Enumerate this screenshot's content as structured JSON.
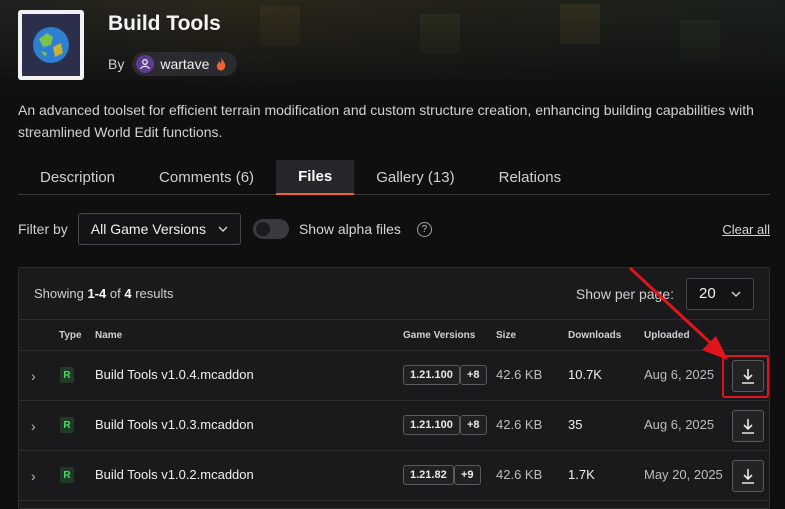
{
  "project": {
    "title": "Build Tools",
    "by_label": "By",
    "author": "wartave",
    "description": "An advanced toolset for efficient terrain modification and custom structure creation, enhancing building capabilities with streamlined World Edit functions."
  },
  "tabs": [
    {
      "label": "Description",
      "active": false
    },
    {
      "label": "Comments (6)",
      "active": false
    },
    {
      "label": "Files",
      "active": true
    },
    {
      "label": "Gallery (13)",
      "active": false
    },
    {
      "label": "Relations",
      "active": false
    }
  ],
  "filters": {
    "filter_label": "Filter by",
    "game_versions": "All Game Versions",
    "alpha_toggle_label": "Show alpha files",
    "clear_all": "Clear all"
  },
  "results": {
    "showing_prefix": "Showing ",
    "showing_range": "1-4",
    "showing_of": " of ",
    "showing_total": "4",
    "showing_suffix": " results",
    "per_page_label": "Show per page:",
    "per_page_value": "20"
  },
  "columns": {
    "type": "Type",
    "name": "Name",
    "game_versions": "Game Versions",
    "size": "Size",
    "downloads": "Downloads",
    "uploaded": "Uploaded"
  },
  "files": [
    {
      "type": "R",
      "name": "Build Tools v1.0.4.mcaddon",
      "version": "1.21.100",
      "more": "+8",
      "size": "42.6 KB",
      "downloads": "10.7K",
      "uploaded": "Aug 6, 2025"
    },
    {
      "type": "R",
      "name": "Build Tools v1.0.3.mcaddon",
      "version": "1.21.100",
      "more": "+8",
      "size": "42.6 KB",
      "downloads": "35",
      "uploaded": "Aug 6, 2025"
    },
    {
      "type": "R",
      "name": "Build Tools v1.0.2.mcaddon",
      "version": "1.21.82",
      "more": "+9",
      "size": "42.6 KB",
      "downloads": "1.7K",
      "uploaded": "May 20, 2025"
    }
  ],
  "colors": {
    "accent": "#f16436",
    "highlight": "#e0141c",
    "release_badge": "#4cd964"
  }
}
